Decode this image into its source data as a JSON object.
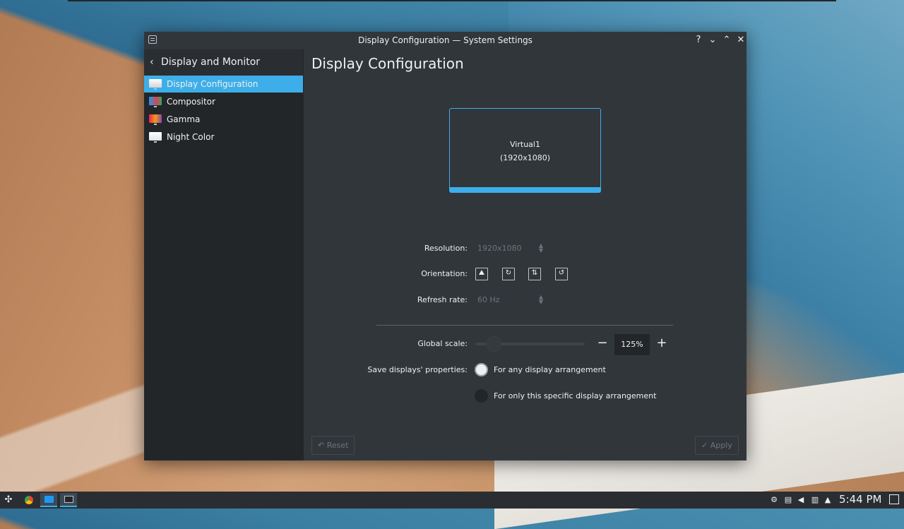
{
  "window": {
    "title": "Display Configuration — System Settings",
    "help_glyph": "?",
    "minimize_glyph": "⌄",
    "maximize_glyph": "⌃",
    "close_glyph": "✕"
  },
  "sidebar": {
    "back_glyph": "‹",
    "heading": "Display and Monitor",
    "items": [
      {
        "label": "Display Configuration",
        "icon": "monitor-icon",
        "active": true
      },
      {
        "label": "Compositor",
        "icon": "compositor-icon",
        "active": false
      },
      {
        "label": "Gamma",
        "icon": "gamma-icon",
        "active": false
      },
      {
        "label": "Night Color",
        "icon": "night-color-icon",
        "active": false
      }
    ]
  },
  "main": {
    "title": "Display Configuration",
    "monitor": {
      "name": "Virtual1",
      "resolution_text": "(1920x1080)"
    },
    "resolution": {
      "label": "Resolution:",
      "value": "1920x1080"
    },
    "orientation": {
      "label": "Orientation:",
      "options": [
        "landscape-icon",
        "portrait-icon",
        "landscape-flipped-icon",
        "portrait-flipped-icon"
      ]
    },
    "refresh_rate": {
      "label": "Refresh rate:",
      "value": "60 Hz"
    },
    "global_scale": {
      "label": "Global scale:",
      "value": "125%",
      "minus": "−",
      "plus": "+"
    },
    "save_properties": {
      "label": "Save displays' properties:",
      "options": [
        {
          "label": "For any display arrangement",
          "checked": true
        },
        {
          "label": "For only this specific display arrangement",
          "checked": false
        }
      ]
    }
  },
  "footer": {
    "reset_label": "Reset",
    "reset_glyph": "↶",
    "apply_label": "Apply",
    "apply_glyph": "✓"
  },
  "taskbar": {
    "launcher_glyph": "✣",
    "clock": "5:44 PM"
  },
  "colors": {
    "accent": "#3daee9",
    "window_bg": "#31363b",
    "sidebar_bg": "#232629"
  }
}
